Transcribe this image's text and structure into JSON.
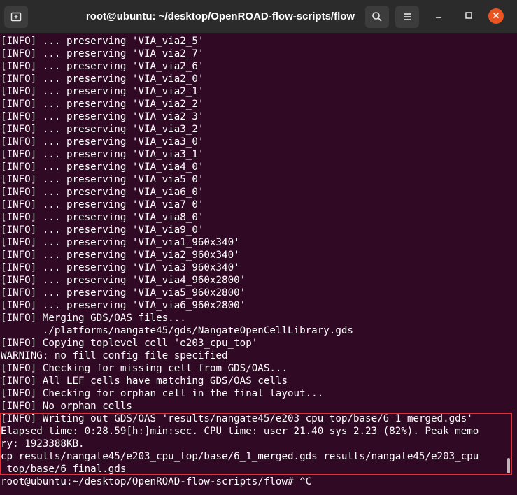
{
  "window": {
    "title": "root@ubuntu: ~/desktop/OpenROAD-flow-scripts/flow"
  },
  "titlebar": {
    "new_tab_icon": "new-tab-icon",
    "search_icon": "search-icon",
    "menu_icon": "hamburger-menu-icon",
    "minimize_icon": "minimize-icon",
    "maximize_icon": "maximize-icon",
    "close_icon": "close-icon"
  },
  "colors": {
    "terminal_bg": "#300a24",
    "titlebar_bg": "#2b2b2b",
    "close_button": "#e95420",
    "highlight_border": "#e0303a",
    "text": "#ffffff"
  },
  "terminal": {
    "lines": [
      "[INFO] ... preserving 'VIA_via2_5'",
      "[INFO] ... preserving 'VIA_via2_7'",
      "[INFO] ... preserving 'VIA_via2_6'",
      "[INFO] ... preserving 'VIA_via2_0'",
      "[INFO] ... preserving 'VIA_via2_1'",
      "[INFO] ... preserving 'VIA_via2_2'",
      "[INFO] ... preserving 'VIA_via2_3'",
      "[INFO] ... preserving 'VIA_via3_2'",
      "[INFO] ... preserving 'VIA_via3_0'",
      "[INFO] ... preserving 'VIA_via3_1'",
      "[INFO] ... preserving 'VIA_via4_0'",
      "[INFO] ... preserving 'VIA_via5_0'",
      "[INFO] ... preserving 'VIA_via6_0'",
      "[INFO] ... preserving 'VIA_via7_0'",
      "[INFO] ... preserving 'VIA_via8_0'",
      "[INFO] ... preserving 'VIA_via9_0'",
      "[INFO] ... preserving 'VIA_via1_960x340'",
      "[INFO] ... preserving 'VIA_via2_960x340'",
      "[INFO] ... preserving 'VIA_via3_960x340'",
      "[INFO] ... preserving 'VIA_via4_960x2800'",
      "[INFO] ... preserving 'VIA_via5_960x2800'",
      "[INFO] ... preserving 'VIA_via6_960x2800'",
      "[INFO] Merging GDS/OAS files...",
      "       ./platforms/nangate45/gds/NangateOpenCellLibrary.gds",
      "[INFO] Copying toplevel cell 'e203_cpu_top'",
      "WARNING: no fill config file specified",
      "[INFO] Checking for missing cell from GDS/OAS...",
      "[INFO] All LEF cells have matching GDS/OAS cells",
      "[INFO] Checking for orphan cell in the final layout...",
      "[INFO] No orphan cells",
      "[INFO] Writing out GDS/OAS 'results/nangate45/e203_cpu_top/base/6_1_merged.gds'",
      "Elapsed time: 0:28.59[h:]min:sec. CPU time: user 21.40 sys 2.23 (82%). Peak memo",
      "ry: 1923388KB.",
      "cp results/nangate45/e203_cpu_top/base/6_1_merged.gds results/nangate45/e203_cpu",
      "_top/base/6_final.gds",
      "root@ubuntu:~/desktop/OpenROAD-flow-scripts/flow# ^C"
    ]
  }
}
